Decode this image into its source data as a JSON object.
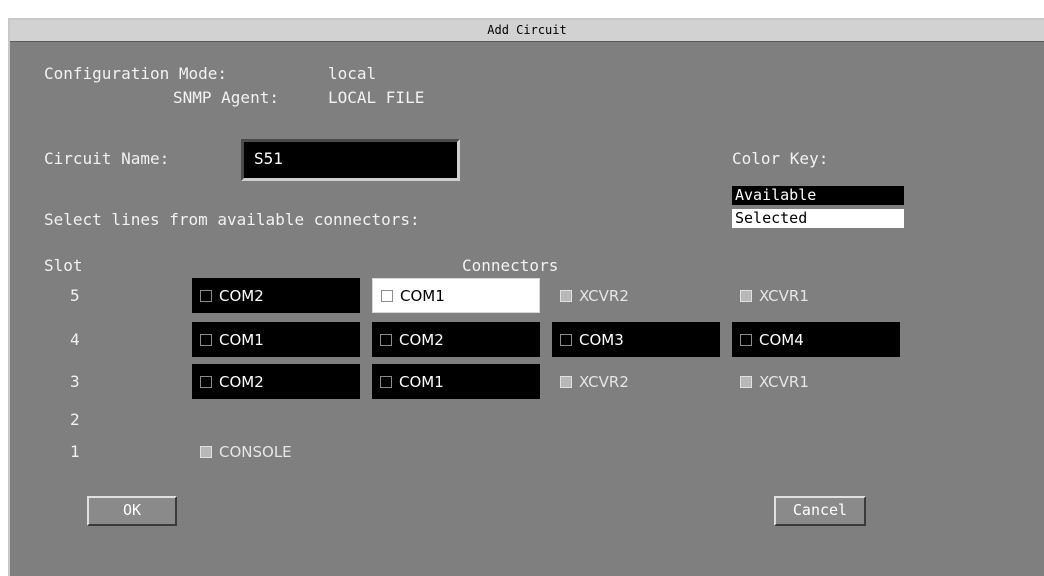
{
  "dialog": {
    "title": "Add Circuit",
    "config_mode_label": "Configuration Mode:",
    "config_mode_value": "local",
    "snmp_agent_label": "SNMP Agent:",
    "snmp_agent_value": "LOCAL FILE",
    "circuit_name_label": "Circuit Name:",
    "circuit_name_value": "S51",
    "color_key_label": "Color Key:",
    "color_key_available": "Available",
    "color_key_selected": "Selected",
    "instructions": "Select lines from available connectors:",
    "slot_header": "Slot",
    "connectors_header": "Connectors",
    "ok_label": "OK",
    "cancel_label": "Cancel"
  },
  "slots": [
    {
      "slot": "5",
      "connectors": [
        {
          "label": "COM2",
          "state": "available"
        },
        {
          "label": "COM1",
          "state": "selected"
        },
        {
          "label": "XCVR2",
          "state": "unavailable"
        },
        {
          "label": "XCVR1",
          "state": "unavailable"
        }
      ]
    },
    {
      "slot": "4",
      "connectors": [
        {
          "label": "COM1",
          "state": "available"
        },
        {
          "label": "COM2",
          "state": "available"
        },
        {
          "label": "COM3",
          "state": "available"
        },
        {
          "label": "COM4",
          "state": "available"
        }
      ]
    },
    {
      "slot": "3",
      "connectors": [
        {
          "label": "COM2",
          "state": "available"
        },
        {
          "label": "COM1",
          "state": "available"
        },
        {
          "label": "XCVR2",
          "state": "unavailable"
        },
        {
          "label": "XCVR1",
          "state": "unavailable"
        }
      ]
    },
    {
      "slot": "2",
      "connectors": []
    },
    {
      "slot": "1",
      "connectors": [
        {
          "label": "CONSOLE",
          "state": "unavailable"
        }
      ]
    }
  ],
  "colors": {
    "window_bg": "#7f7f7f",
    "available_bg": "#000000",
    "selected_bg": "#ffffff",
    "title_bg": "#d2d2d2"
  }
}
